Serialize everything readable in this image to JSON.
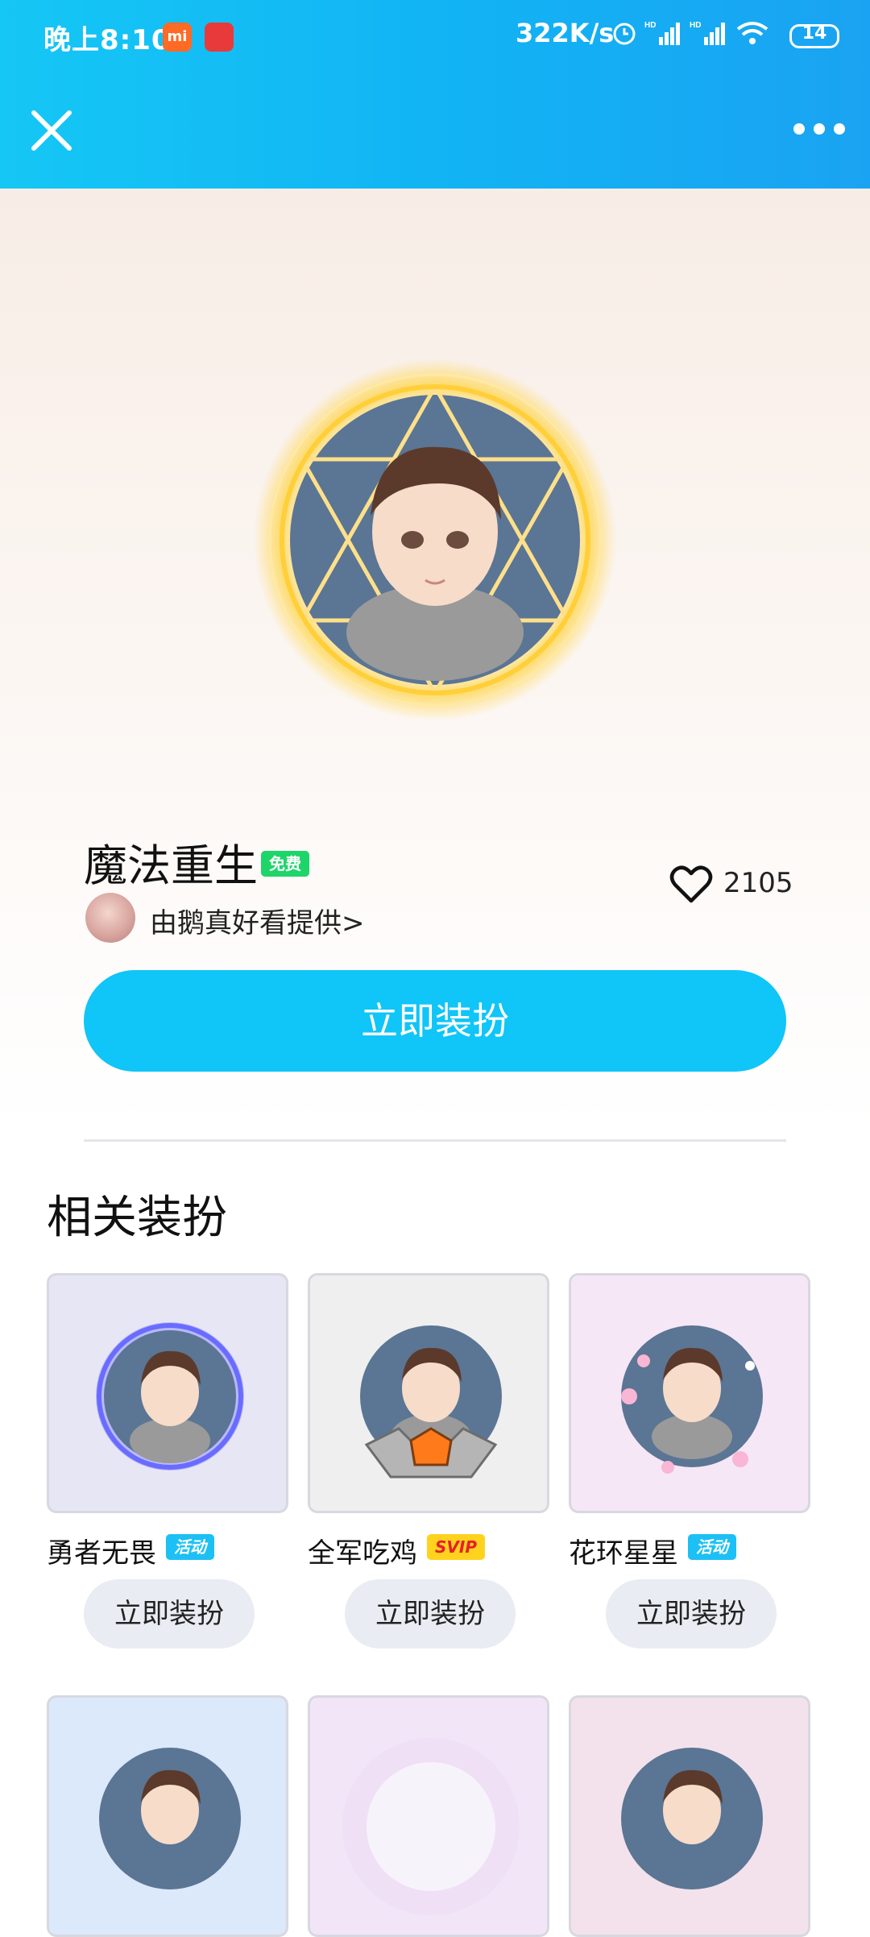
{
  "status_bar": {
    "time": "晚上8:10",
    "speed": "322K/s",
    "battery": "14"
  },
  "header": {
    "close_icon": "close-icon",
    "more_icon": "more-dots-icon"
  },
  "item": {
    "name": "魔法重生",
    "tag": "免费",
    "provider": "由鹅真好看提供>",
    "likes": "2105",
    "apply_label": "立即装扮"
  },
  "related": {
    "title": "相关装扮",
    "items": [
      {
        "name": "勇者无畏",
        "tag": "活动",
        "button": "立即装扮"
      },
      {
        "name": "全军吃鸡",
        "tag": "SVIP",
        "button": "立即装扮"
      },
      {
        "name": "花环星星",
        "tag": "活动",
        "button": "立即装扮"
      }
    ]
  },
  "colors": {
    "accent": "#10c5f7",
    "free_tag": "#1ed56a",
    "svip_tag": "#ffd21e"
  }
}
